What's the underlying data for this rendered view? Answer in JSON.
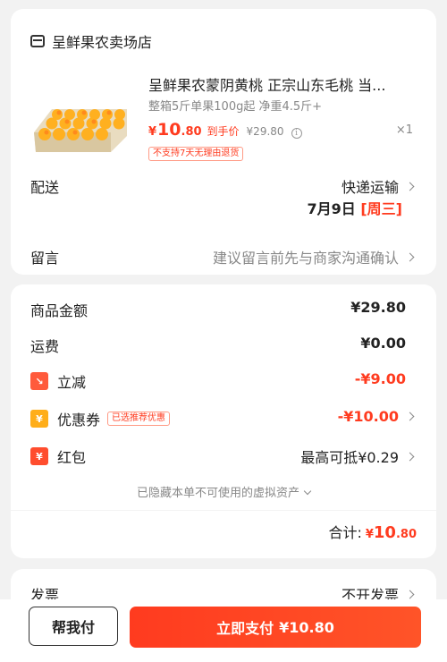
{
  "store": {
    "name": "呈鲜果农卖场店",
    "icon": "store-icon"
  },
  "product": {
    "title": "呈鲜果农蒙阴黄桃 正宗山东毛桃 当...",
    "spec": "整箱5斤单果100g起 净重4.5斤+",
    "price_currency": "¥",
    "price_int": "10",
    "price_dec": ".80",
    "price_label": "到手价",
    "original_price": "¥29.80",
    "quantity": "×1",
    "return_badge": "不支持7天无理由退货"
  },
  "delivery": {
    "label": "配送",
    "method": "快递运输",
    "date": "7月9日",
    "weekday": "[周三]"
  },
  "message": {
    "label": "留言",
    "placeholder": "建议留言前先与商家沟通确认"
  },
  "summary": {
    "goods_label": "商品金额",
    "goods_value": "¥29.80",
    "shipping_label": "运费",
    "shipping_value": "¥0.00",
    "discount_label": "立减",
    "discount_value": "-¥9.00",
    "coupon_label": "优惠券",
    "coupon_tag": "已选推荐优惠",
    "coupon_value": "-¥10.00",
    "redpacket_label": "红包",
    "redpacket_value": "最高可抵¥0.29",
    "hidden_assets": "已隐藏本单不可使用的虚拟资产",
    "total_label": "合计:",
    "total_currency": "¥",
    "total_int": "10",
    "total_dec": ".80"
  },
  "invoice": {
    "label": "发票",
    "value": "不开发票"
  },
  "bottom": {
    "help_button": "帮我付",
    "pay_button": "立即支付",
    "pay_amount": "¥10.80"
  },
  "colors": {
    "accent": "#ff3b1f",
    "coupon_icon": "#ffae1a",
    "discount_icon": "#ff5a3c"
  }
}
